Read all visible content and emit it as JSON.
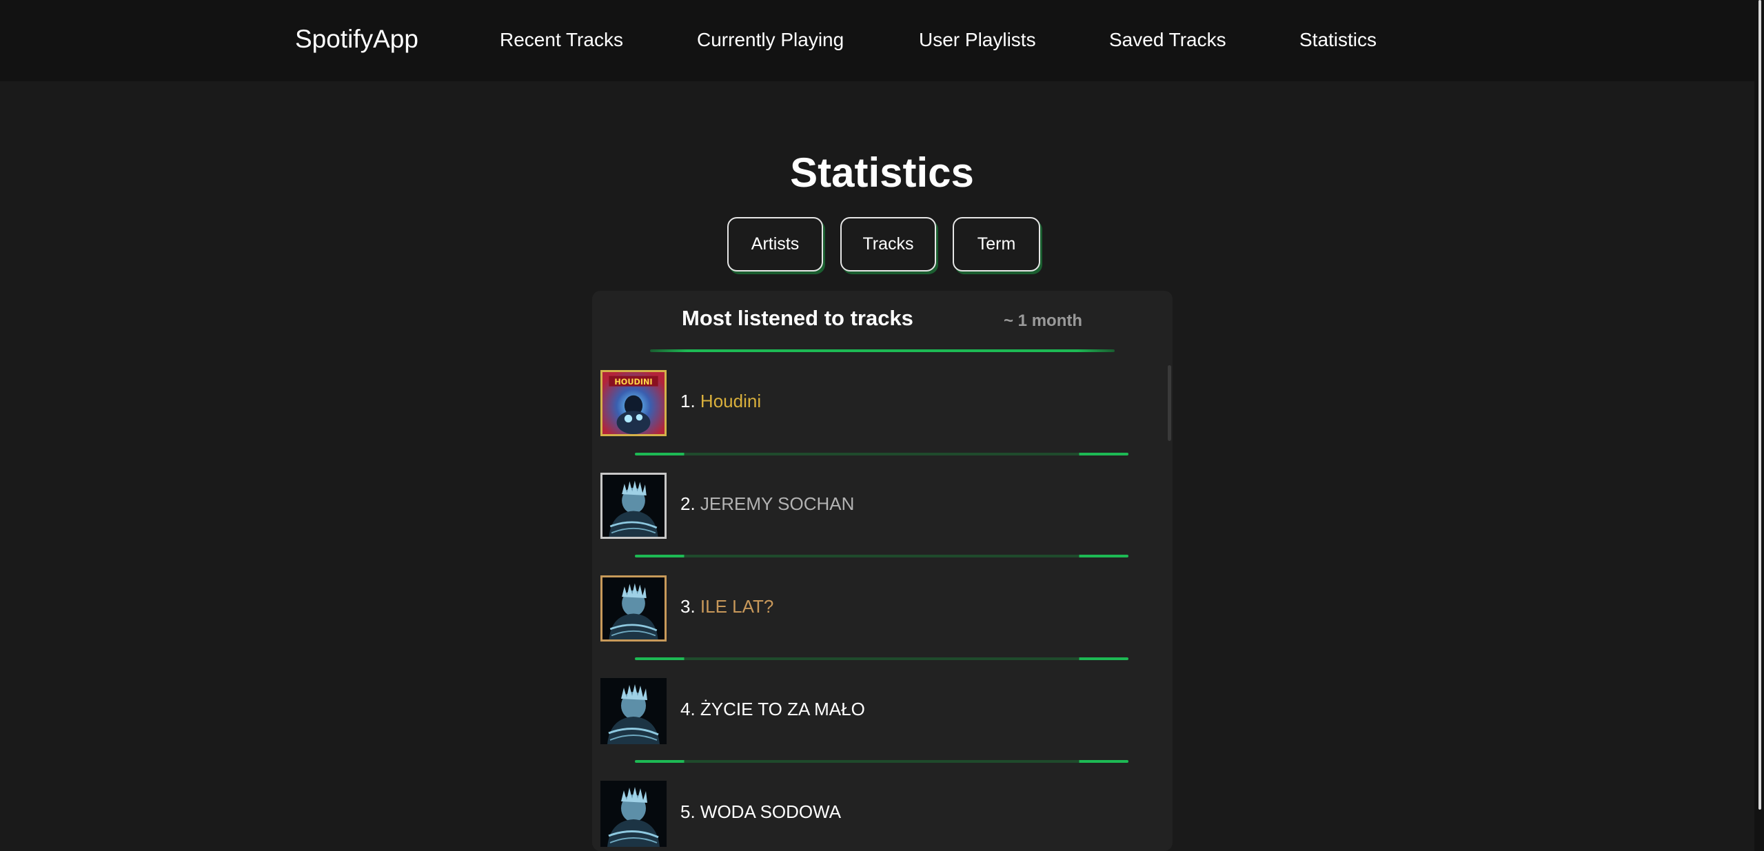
{
  "nav": {
    "brand": "SpotifyApp",
    "links": [
      "Recent Tracks",
      "Currently Playing",
      "User Playlists",
      "Saved Tracks",
      "Statistics"
    ]
  },
  "page": {
    "title": "Statistics",
    "buttons": [
      "Artists",
      "Tracks",
      "Term"
    ]
  },
  "panel": {
    "heading": "Most listened to tracks",
    "term": "~ 1 month",
    "tracks": [
      {
        "rank": "1.",
        "title": "Houdini",
        "title_color": "#d9b03c",
        "border_color": "#d4b24a",
        "cover_text": "HOUDINI"
      },
      {
        "rank": "2.",
        "title": "JEREMY SOCHAN",
        "title_color": "#b3b3b3",
        "border_color": "#c8c8c8"
      },
      {
        "rank": "3.",
        "title": "ILE LAT?",
        "title_color": "#c8985a",
        "border_color": "#c89a5a"
      },
      {
        "rank": "4.",
        "title": "ŻYCIE TO ZA MAŁO",
        "title_color": "#ffffff",
        "border_color": ""
      },
      {
        "rank": "5.",
        "title": "WODA SODOWA",
        "title_color": "#ffffff",
        "border_color": ""
      }
    ]
  },
  "colors": {
    "accent": "#1db954",
    "background": "#1a1a1a",
    "navbar": "#121212",
    "panel": "#222222"
  }
}
